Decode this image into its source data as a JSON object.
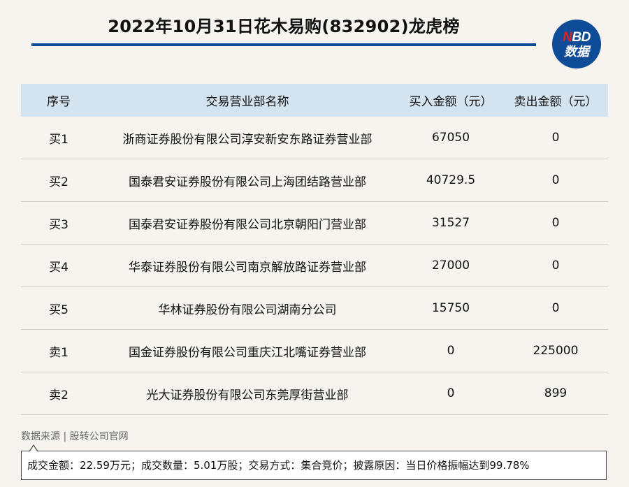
{
  "header": {
    "title": "2022年10月31日花木易购(832902)龙虎榜",
    "logo_line1_accent": "N",
    "logo_line1_rest": "BD",
    "logo_line2": "数据"
  },
  "table": {
    "columns": [
      "序号",
      "交易营业部名称",
      "买入金额（元）",
      "卖出金额（元）"
    ],
    "rows": [
      [
        "买1",
        "浙商证券股份有限公司淳安新安东路证券营业部",
        "67050",
        "0"
      ],
      [
        "买2",
        "国泰君安证券股份有限公司上海团结路营业部",
        "40729.5",
        "0"
      ],
      [
        "买3",
        "国泰君安证券股份有限公司北京朝阳门营业部",
        "31527",
        "0"
      ],
      [
        "买4",
        "华泰证券股份有限公司南京解放路证券营业部",
        "27000",
        "0"
      ],
      [
        "买5",
        "华林证券股份有限公司湖南分公司",
        "15750",
        "0"
      ],
      [
        "卖1",
        "国金证券股份有限公司重庆江北嘴证券营业部",
        "0",
        "225000"
      ],
      [
        "卖2",
        "光大证券股份有限公司东莞厚街营业部",
        "0",
        "899"
      ]
    ]
  },
  "footer": {
    "source": "数据来源 | 股转公司官网",
    "summary": "成交金额：22.59万元；成交数量：5.01万股；交易方式：集合竞价；披露原因：当日价格振幅达到99.78%"
  },
  "colors": {
    "brand_blue": "#0e4c97",
    "header_bg": "#d3e3f0",
    "page_bg": "#f7f4ef",
    "logo_accent": "#e2231a"
  }
}
